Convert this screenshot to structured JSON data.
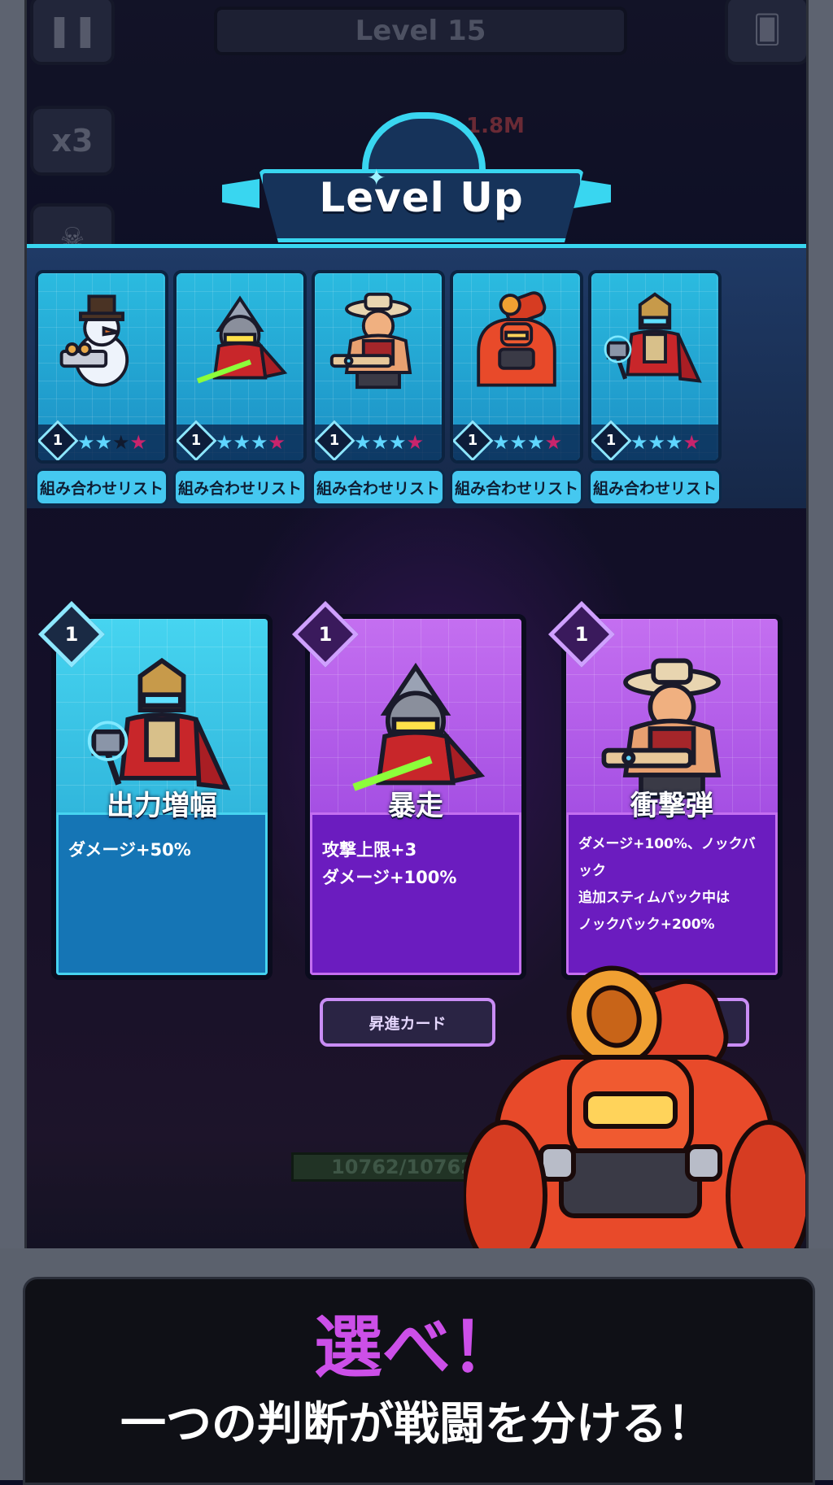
{
  "hud": {
    "pause_icon": "pause-icon",
    "level_label": "Level 15",
    "speed_label": "x3",
    "cards_icon": "cards-icon",
    "skull_icon": "skull-icon",
    "damage_float": "1.8M",
    "hp_text": "10762/10762"
  },
  "banner": {
    "title": "Level Up",
    "sparkle": "✦"
  },
  "roster": [
    {
      "hero": "snowman-gunner",
      "level": "1",
      "stars_on": 2,
      "stars_total": 4,
      "star_colors": [
        "on",
        "on",
        "off",
        "pink"
      ],
      "combo_label": "組み合わせリスト"
    },
    {
      "hero": "red-ninja",
      "level": "1",
      "star_colors": [
        "on",
        "on",
        "on",
        "pink"
      ],
      "combo_label": "組み合わせリスト"
    },
    {
      "hero": "cowboy-gunner",
      "level": "1",
      "star_colors": [
        "on",
        "on",
        "on",
        "pink"
      ],
      "combo_label": "組み合わせリスト"
    },
    {
      "hero": "red-mech",
      "level": "1",
      "star_colors": [
        "on",
        "on",
        "on",
        "pink"
      ],
      "combo_label": "組み合わせリスト"
    },
    {
      "hero": "thor-knight",
      "level": "1",
      "star_colors": [
        "on",
        "on",
        "on",
        "pink"
      ],
      "combo_label": "組み合わせリスト"
    }
  ],
  "choices": [
    {
      "theme": "blue",
      "level": "1",
      "hero": "thor-knight",
      "name": "出力増幅",
      "desc_lines": [
        "ダメージ+50%"
      ]
    },
    {
      "theme": "purple",
      "level": "1",
      "hero": "red-ninja",
      "name": "暴走",
      "desc_lines": [
        "攻撃上限+3",
        "ダメージ+100%"
      ]
    },
    {
      "theme": "purple",
      "level": "1",
      "hero": "cowboy-gunner",
      "name": "衝撃弾",
      "desc_lines": [
        "ダメージ+100%、ノックバック",
        "追加スティムパック中は",
        "ノックバック+200%"
      ]
    }
  ],
  "promo_label": "昇進カード",
  "caption": {
    "title": "選べ！",
    "subtitle": "一つの判断が戦闘を分ける！"
  },
  "colors": {
    "accent_cyan": "#39d6f0",
    "accent_purple": "#cc4fe8",
    "card_blue": "#1575b5",
    "card_purple": "#6b1cbf"
  }
}
